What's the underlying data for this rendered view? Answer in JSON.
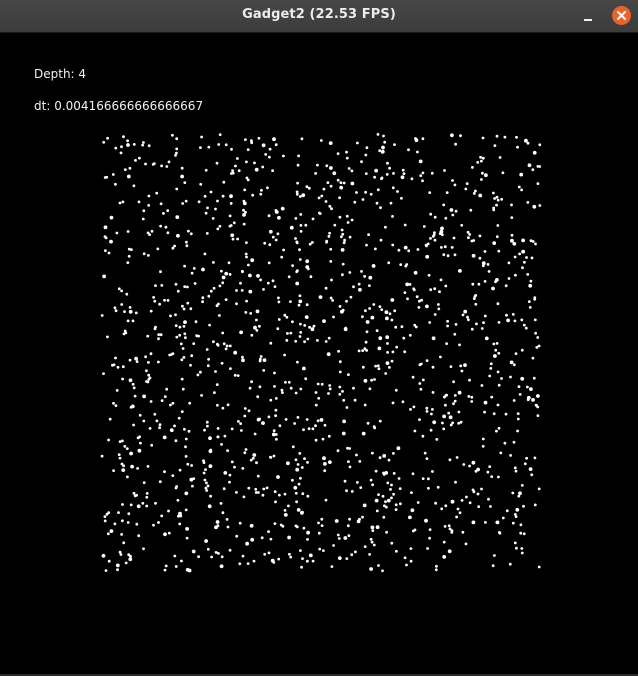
{
  "window": {
    "title": "Gadget2 (22.53 FPS)",
    "accent": "#e9632f"
  },
  "controls": {
    "minimize_icon": "minimize-icon",
    "close_icon": "close-icon"
  },
  "hud": {
    "depth_label": "Depth:",
    "depth_value": "4",
    "dt_label": "dt:",
    "dt_value": "0.004166666666666667"
  },
  "simulation": {
    "background": "#000000",
    "particle_color": "#ffffff",
    "particle_count": 1400
  }
}
